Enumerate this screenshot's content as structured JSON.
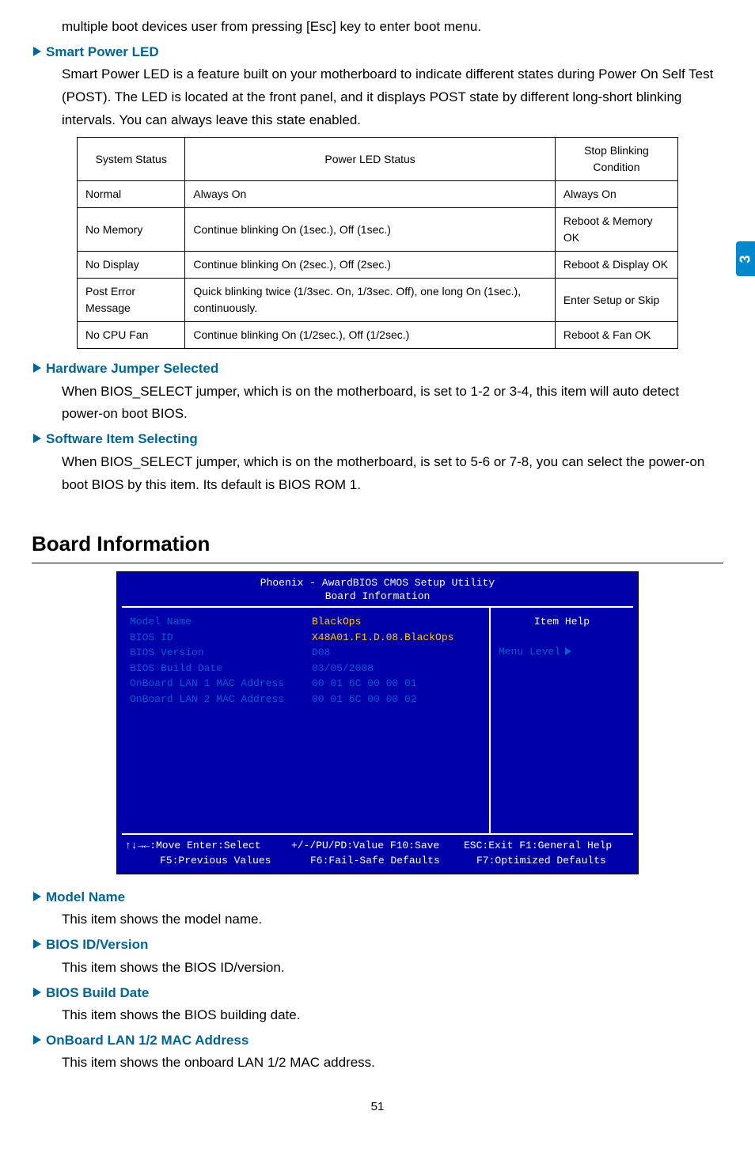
{
  "intro_text": "multiple boot devices user from pressing [Esc] key to enter boot menu.",
  "side_tab": "3",
  "spl": {
    "header": "Smart Power LED",
    "text": "Smart Power LED is a feature built on your motherboard to indicate different states during Power On Self Test (POST). The LED is located at the front panel, and it displays POST state by different long-short blinking intervals. You can always leave this state enabled."
  },
  "led_table": {
    "headers": [
      "System Status",
      "Power LED Status",
      "Stop Blinking Condition"
    ],
    "rows": [
      [
        "Normal",
        "Always On",
        "Always On"
      ],
      [
        "No Memory",
        "Continue blinking On (1sec.), Off (1sec.)",
        "Reboot & Memory OK"
      ],
      [
        "No Display",
        "Continue blinking On (2sec.), Off (2sec.)",
        "Reboot & Display OK"
      ],
      [
        "Post Error Message",
        "Quick blinking twice (1/3sec. On, 1/3sec. Off), one long On (1sec.), continuously.",
        "Enter Setup or Skip"
      ],
      [
        "No CPU Fan",
        "Continue blinking On (1/2sec.), Off (1/2sec.)",
        "Reboot & Fan OK"
      ]
    ]
  },
  "hjs": {
    "header": "Hardware Jumper Selected",
    "text": "When BIOS_SELECT jumper, which is on the motherboard, is set to 1-2 or 3-4, this item will auto detect power-on boot BIOS."
  },
  "sis": {
    "header": "Software Item Selecting",
    "text": "When BIOS_SELECT jumper, which is on the motherboard, is set to 5-6 or 7-8, you can select the power-on boot BIOS by this item. Its default is BIOS ROM 1."
  },
  "section_title": "Board Information",
  "bios": {
    "title1": "Phoenix - AwardBIOS CMOS Setup Utility",
    "title2": "Board Information",
    "rows": [
      {
        "label": "Model Name",
        "value": "BlackOps",
        "yellow": true
      },
      {
        "label": "BIOS ID",
        "value": "X48A01.F1.D.08.BlackOps",
        "yellow": true
      },
      {
        "label": "BIOS Version",
        "value": "D08",
        "yellow": false
      },
      {
        "label": "BIOS Build Date",
        "value": "03/05/2008",
        "yellow": false
      },
      {
        "label": "OnBoard LAN 1 MAC Address",
        "value": "00 01 6C 00 00 01",
        "yellow": false
      },
      {
        "label": "OnBoard LAN 2 MAC Address",
        "value": "00 01 6C 00 00 02",
        "yellow": false
      }
    ],
    "help_title": "Item Help",
    "menu_level": "Menu Level",
    "footer": {
      "l1": "↑↓→←:Move   Enter:Select",
      "l2": "F5:Previous Values",
      "c1": "+/-/PU/PD:Value   F10:Save",
      "c2": "F6:Fail-Safe Defaults",
      "r1": "ESC:Exit   F1:General Help",
      "r2": "F7:Optimized Defaults"
    }
  },
  "mn": {
    "header": "Model Name",
    "text": "This item shows the model name."
  },
  "biv": {
    "header": "BIOS ID/Version",
    "text": "This item shows the BIOS ID/version."
  },
  "bbd": {
    "header": "BIOS Build Date",
    "text": "This item shows the BIOS building date."
  },
  "mac": {
    "header": "OnBoard LAN 1/2 MAC Address",
    "text": "This item shows the onboard LAN 1/2 MAC address."
  },
  "page_num": "51"
}
